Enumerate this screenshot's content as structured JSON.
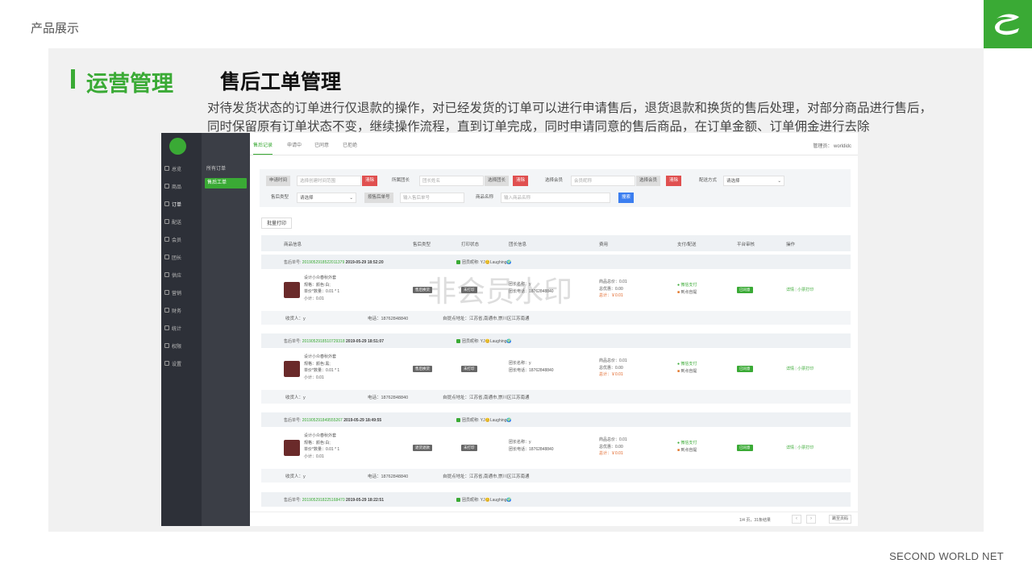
{
  "slide": {
    "top_label": "产品展示",
    "section_title": "运营管理",
    "page_title": "售后工单管理",
    "desc_line1": "对待发货状态的订单进行仅退款的操作，对已经发货的订单可以进行申请售后，退货退款和换货的售后处理，对部分商品进行售后，",
    "desc_line2": "同时保留原有订单状态不变，继续操作流程，直到订单完成，同时申请同意的售后商品，在订单金额、订单佣金进行去除",
    "footer": "SECOND WORLD NET",
    "accent_color": "#3aaa35"
  },
  "app": {
    "watermark": "非会员水印",
    "sidebar": {
      "items": [
        {
          "label": "总览",
          "icon": "dashboard-icon"
        },
        {
          "label": "商品",
          "icon": "goods-icon"
        },
        {
          "label": "订单",
          "icon": "order-icon"
        },
        {
          "label": "配送",
          "icon": "delivery-icon"
        },
        {
          "label": "会员",
          "icon": "member-icon"
        },
        {
          "label": "团长",
          "icon": "leader-icon"
        },
        {
          "label": "供应",
          "icon": "supply-icon"
        },
        {
          "label": "营销",
          "icon": "marketing-icon"
        },
        {
          "label": "财务",
          "icon": "finance-icon"
        },
        {
          "label": "统计",
          "icon": "stats-icon"
        },
        {
          "label": "权限",
          "icon": "permission-icon"
        },
        {
          "label": "设置",
          "icon": "settings-icon"
        }
      ]
    },
    "subnav": {
      "title": "所有订单",
      "active": "售后工单"
    },
    "tabs": [
      "售后记录",
      "申请中",
      "已同意",
      "已拒绝"
    ],
    "admin": "管理员： worldidc",
    "filter": {
      "apply_time_label": "申请时间",
      "apply_time_placeholder": "选择创建时间范围",
      "clear": "清除",
      "leader_label": "所属团长",
      "leader_placeholder": "团长姓名",
      "select_leader": "选择团长",
      "member_label": "选择会员",
      "member_placeholder": "会员昵称",
      "select_member": "选择会员",
      "ship_label": "配送方式",
      "ship_value": "请选择",
      "type_label": "售后类型",
      "type_value": "请选择",
      "search_by": "按售后单号",
      "search_placeholder": "输入售后单号",
      "goods_label": "商品名称",
      "goods_placeholder": "输入商品名称",
      "search_button": "搜索"
    },
    "batch_print": "批量打印",
    "columns": [
      "商品信息",
      "售后类型",
      "打印状态",
      "团长信息",
      "费用",
      "支付/配送",
      "平台审核",
      "操作"
    ],
    "orders": [
      {
        "no_prefix": "售后单号:",
        "no": "20190529185220113​79",
        "datetime": "2019-05-29 18:52:20",
        "member": "团员昵称: YJ😊Laughing🌍",
        "goods": "设计小众春秋外套",
        "spec": "规格：颜色:白;",
        "price": "单价*数量：0.01 * 1",
        "subtotal": "小计：0.01",
        "type": "售后换货",
        "print": "未打印",
        "leader_name": "团长名称：y",
        "leader_phone": "团长电话：18762848840",
        "total": "商品总价：0.01",
        "discount": "总优惠：0.00",
        "sum": "总计：￥0.01",
        "pay": "微信支付",
        "ship": "到点自提",
        "audit": "已同意",
        "op_detail": "详情",
        "op_print": "小票打印",
        "receiver": "收货人：y",
        "phone": "电话：18762848840",
        "address": "自提点地址：江苏省,南通市,崇川区江苏南通"
      },
      {
        "no_prefix": "售后单号:",
        "no": "20190529185107293​18",
        "datetime": "2019-05-29 18:51:07",
        "member": "团员昵称: YJ😊Laughing🌍",
        "goods": "设计小众春秋外套",
        "spec": "规格：颜色:黑;",
        "price": "单价*数量：0.01 * 1",
        "subtotal": "小计：0.01",
        "type": "售后换货",
        "print": "未打印",
        "leader_name": "团长名称：y",
        "leader_phone": "团长电话：18762848840",
        "total": "商品总价：0.01",
        "discount": "总优惠：0.00",
        "sum": "总计：￥0.01",
        "pay": "微信支付",
        "ship": "到点自提",
        "audit": "已同意",
        "op_detail": "详情",
        "op_print": "小票打印",
        "receiver": "收货人：y",
        "phone": "电话：18762848840",
        "address": "自提点地址：江苏省,南通市,崇川区江苏南通"
      },
      {
        "no_prefix": "售后单号:",
        "no": "20190529184955526​7",
        "datetime": "2019-05-29 18:49:55",
        "member": "团员昵称: YJ😊Laughing🌍",
        "goods": "设计小众春秋外套",
        "spec": "规格：颜色:白;",
        "price": "单价*数量：0.01 * 1",
        "subtotal": "小计：0.01",
        "type": "退货退款",
        "print": "未打印",
        "leader_name": "团长名称：y",
        "leader_phone": "团长电话：18762848840",
        "total": "商品总价：0.01",
        "discount": "总优惠：0.00",
        "sum": "总计：￥0.01",
        "pay": "微信支付",
        "ship": "到点自提",
        "audit": "已同意",
        "op_detail": "详情",
        "op_print": "小票打印",
        "receiver": "收货人：y",
        "phone": "电话：18762848840",
        "address": "自提点地址：江苏省,南通市,崇川区江苏南通"
      }
    ],
    "partial_order": {
      "no_prefix": "售后单号:",
      "no": "20190529182251684​70",
      "datetime": "2019-05-29 18:22:51",
      "member": "团员昵称: YJ😊Laughing🌍"
    },
    "pager": {
      "text": "1/4 页，31条结果",
      "prev": "‹",
      "next": "›",
      "jump": "跳至页码"
    }
  }
}
